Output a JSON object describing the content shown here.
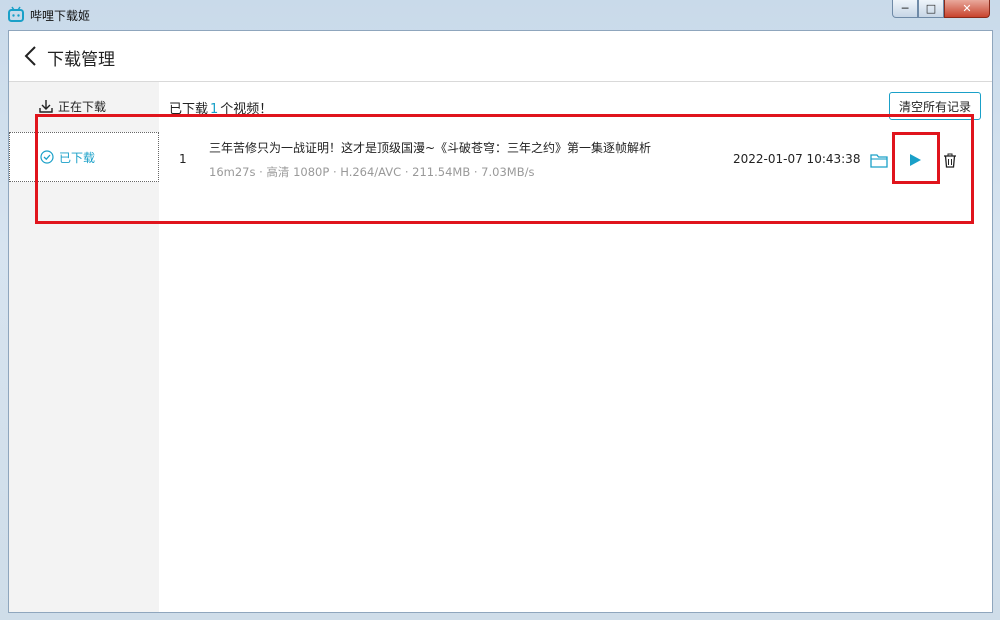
{
  "window": {
    "app_title": "哔哩下载姬",
    "minimize_glyph": "─",
    "maximize_glyph": "□",
    "close_glyph": "✕"
  },
  "header": {
    "title": "下载管理",
    "back_icon": "chevron-left-icon"
  },
  "sidebar": {
    "items": [
      {
        "label": "正在下载",
        "icon": "download-icon",
        "active": false
      },
      {
        "label": "已下载",
        "icon": "check-circle-icon",
        "active": true
      }
    ]
  },
  "summary": {
    "prefix": "已下载",
    "count": "1",
    "suffix": "个视频！"
  },
  "clear_button": {
    "label": "清空所有记录"
  },
  "downloads": [
    {
      "index": "1",
      "title": "三年苦修只为一战证明！这才是顶级国漫~《斗破苍穹：三年之约》第一集逐帧解析",
      "meta": "16m27s · 高清 1080P · H.264/AVC · 211.54MB · 7.03MB/s",
      "date": "2022-01-07 10:43:38",
      "actions": [
        "folder-icon",
        "play-icon",
        "trash-icon"
      ]
    }
  ],
  "colors": {
    "accent": "#1aa0c8",
    "annotation": "#e0141c",
    "meta_text": "#999999"
  }
}
